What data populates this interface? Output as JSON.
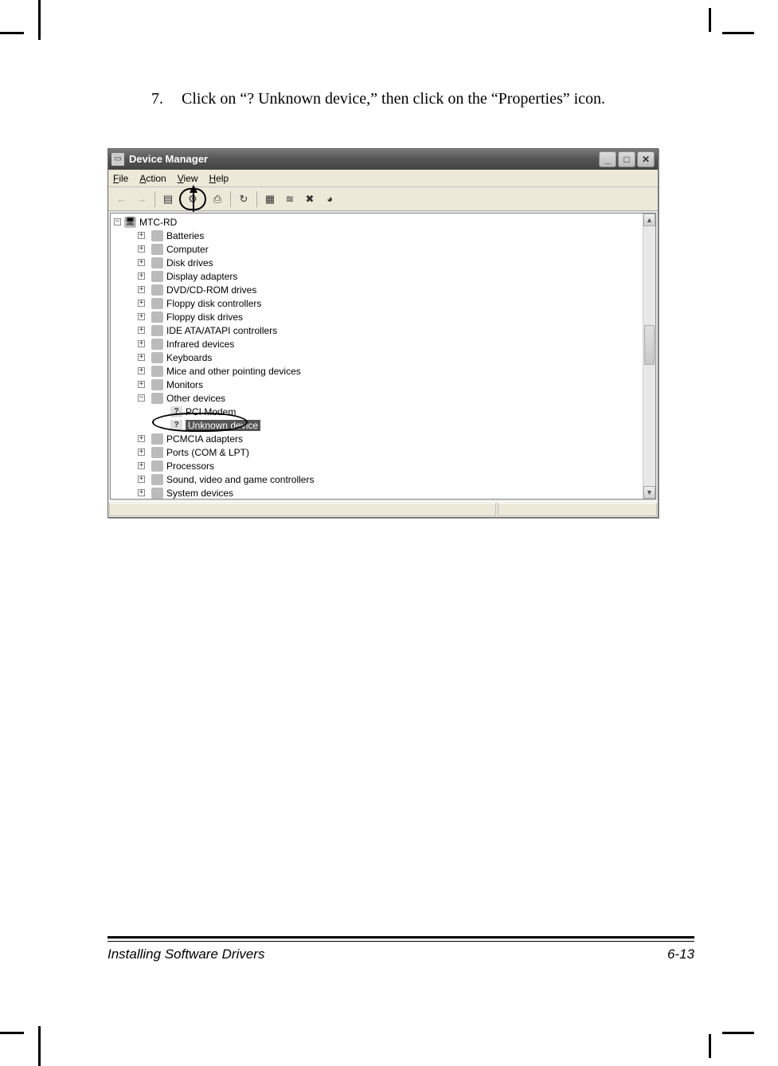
{
  "instruction": {
    "number": "7.",
    "text": "Click on “? Unknown device,” then click on the “Properties” icon."
  },
  "window": {
    "title": "Device Manager",
    "controls": {
      "minimize": "_",
      "maximize": "□",
      "close": "✕"
    },
    "menubar": [
      "File",
      "Action",
      "View",
      "Help"
    ],
    "toolbar": {
      "back": "←",
      "forward": "→",
      "up": "▤",
      "properties": "⚙",
      "print": "⎙",
      "refresh": "↻",
      "scan": "▦",
      "uninstall": "✖",
      "update": "█",
      "help": "?"
    },
    "tree": {
      "root": "MTC-RD",
      "items": [
        {
          "label": "Batteries",
          "expand": "+"
        },
        {
          "label": "Computer",
          "expand": "+"
        },
        {
          "label": "Disk drives",
          "expand": "+"
        },
        {
          "label": "Display adapters",
          "expand": "+"
        },
        {
          "label": "DVD/CD-ROM drives",
          "expand": "+"
        },
        {
          "label": "Floppy disk controllers",
          "expand": "+"
        },
        {
          "label": "Floppy disk drives",
          "expand": "+"
        },
        {
          "label": "IDE ATA/ATAPI controllers",
          "expand": "+"
        },
        {
          "label": "Infrared devices",
          "expand": "+"
        },
        {
          "label": "Keyboards",
          "expand": "+"
        },
        {
          "label": "Mice and other pointing devices",
          "expand": "+"
        },
        {
          "label": "Monitors",
          "expand": "+"
        },
        {
          "label": "Other devices",
          "expand": "−",
          "children": [
            {
              "label": "PCI Modem",
              "icon": "?"
            },
            {
              "label": "Unknown device",
              "icon": "?",
              "selected": true
            }
          ]
        },
        {
          "label": "PCMCIA adapters",
          "expand": "+"
        },
        {
          "label": "Ports (COM & LPT)",
          "expand": "+"
        },
        {
          "label": "Processors",
          "expand": "+"
        },
        {
          "label": "Sound, video and game controllers",
          "expand": "+"
        },
        {
          "label": "System devices",
          "expand": "+"
        }
      ]
    }
  },
  "footer": {
    "section": "Installing Software Drivers",
    "page": "6-13"
  }
}
